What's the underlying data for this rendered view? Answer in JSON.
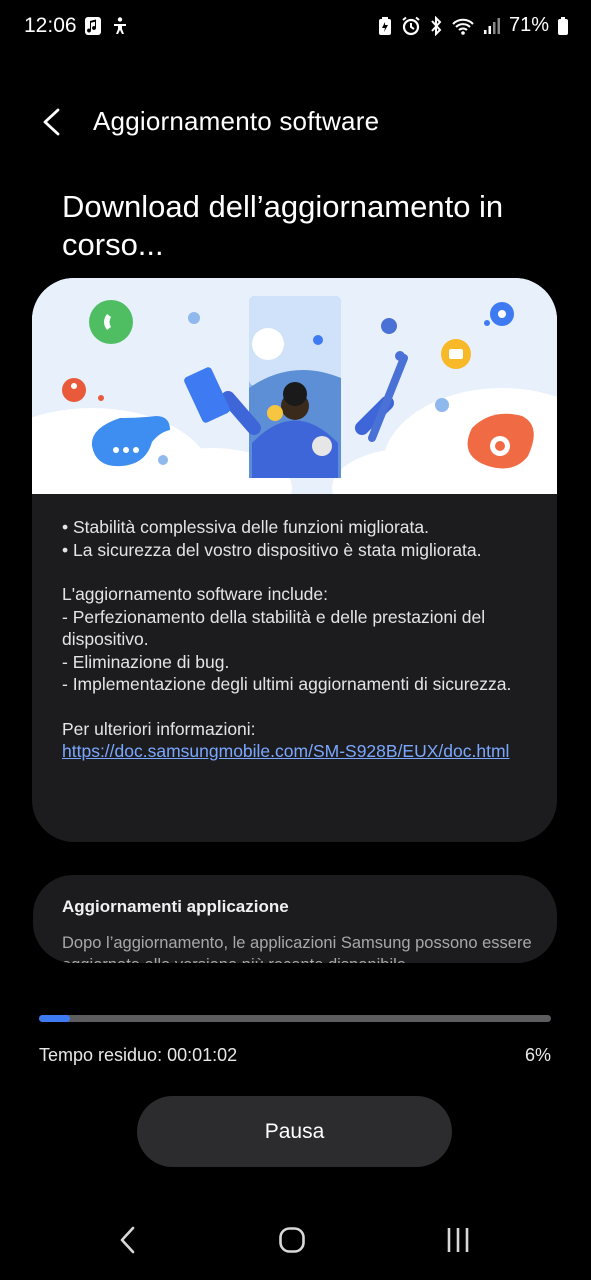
{
  "status_bar": {
    "time": "12:06",
    "battery": "71%",
    "icons": [
      "music-note-icon",
      "accessibility-icon",
      "battery-saver-icon",
      "alarm-icon",
      "bluetooth-icon",
      "wifi-icon",
      "signal-icon",
      "battery-icon"
    ]
  },
  "header": {
    "title": "Aggiornamento software",
    "back_icon": "chevron-left-icon"
  },
  "heading": "Download dell’aggiornamento in corso...",
  "info_card": {
    "bullets": [
      "• Stabilità complessiva delle funzioni migliorata.",
      "• La sicurezza del vostro dispositivo è stata migliorata."
    ],
    "includes_title": "L'aggiornamento software include:",
    "includes": [
      "- Perfezionamento della stabilità e delle prestazioni del dispositivo.",
      "- Eliminazione di bug.",
      "- Implementazione degli ultimi aggiornamenti di sicurezza."
    ],
    "more_info_label": "Per ulteriori informazioni:",
    "more_info_link": "https://doc.samsungmobile.com/SM-S928B/EUX/doc.html"
  },
  "apps_card": {
    "title": "Aggiornamenti applicazione",
    "description": "Dopo l’aggiornamento, le applicazioni Samsung possono essere aggiornate alla versione più recente disponibile."
  },
  "progress": {
    "fraction": 0.06,
    "time_left": "Tempo residuo: 00:01:02",
    "percent": "6%"
  },
  "pause_label": "Pausa",
  "colors": {
    "accent": "#3e7bf2",
    "link": "#7aa7ff",
    "card": "#1c1c1e",
    "illustration_bg": "#e8f0fc"
  }
}
